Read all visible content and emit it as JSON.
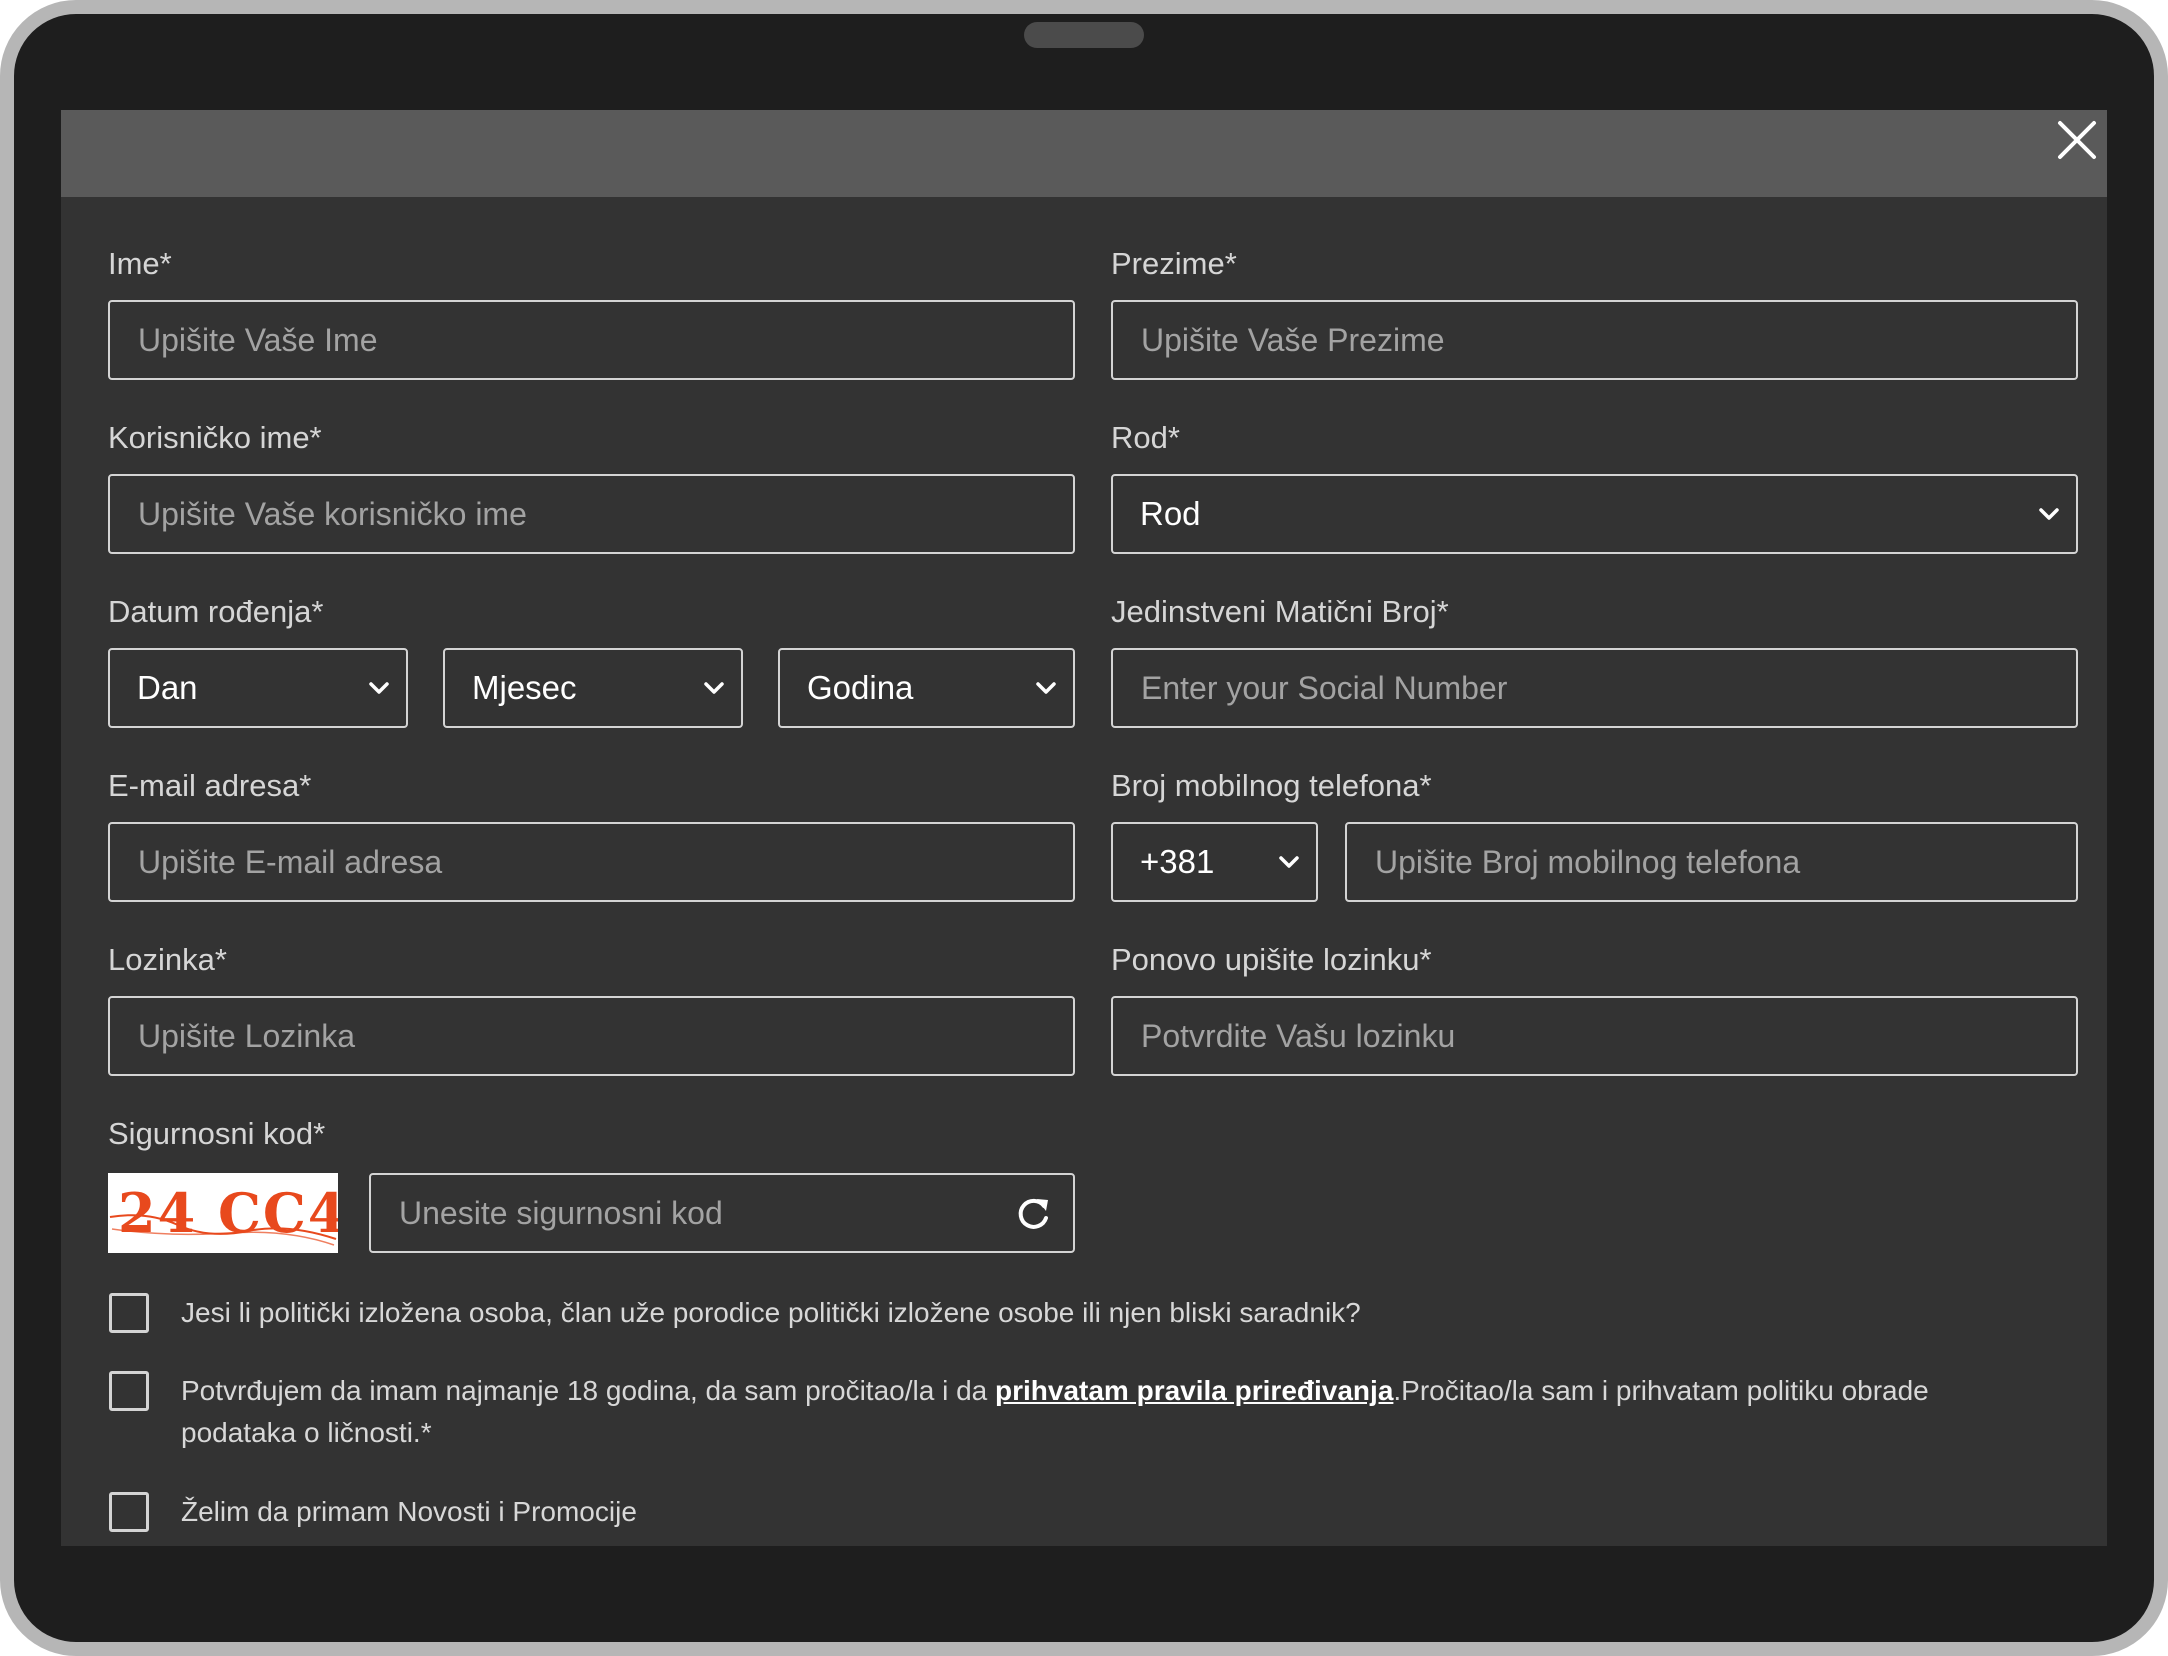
{
  "form": {
    "first_name": {
      "label": "Ime*",
      "placeholder": "Upišite Vaše Ime"
    },
    "last_name": {
      "label": "Prezime*",
      "placeholder": "Upišite Vaše Prezime"
    },
    "username": {
      "label": "Korisničko ime*",
      "placeholder": "Upišite Vaše korisničko ime"
    },
    "gender": {
      "label": "Rod*",
      "selected": "Rod"
    },
    "birth_date": {
      "label": "Datum rođenja*",
      "day": "Dan",
      "month": "Mjesec",
      "year": "Godina"
    },
    "jmbg": {
      "label": "Jedinstveni Matični Broj*",
      "placeholder": "Enter your Social Number"
    },
    "email": {
      "label": "E-mail adresa*",
      "placeholder": "Upišite E-mail adresa"
    },
    "phone": {
      "label": "Broj mobilnog telefona*",
      "country_code": "+381",
      "placeholder": "Upišite Broj mobilnog telefona"
    },
    "password": {
      "label": "Lozinka*",
      "placeholder": "Upišite Lozinka"
    },
    "password_confirm": {
      "label": "Ponovo upišite lozinku*",
      "placeholder": "Potvrdite Vašu lozinku"
    },
    "captcha": {
      "label": "Sigurnosni kod*",
      "code": "24 CC4",
      "placeholder": "Unesite sigurnosni kod"
    },
    "checkboxes": {
      "pep": "Jesi li politički izložena osoba, član uže porodice politički izložene osobe ili njen bliski saradnik?",
      "terms_before": "Potvrđujem da imam najmanje 18 godina, da sam pročitao/la i da ",
      "terms_link": "prihvatam pravila priređivanja",
      "terms_after": ".Pročitao/la sam i prihvatam politiku obrade podataka o ličnosti.*",
      "news": "Želim da primam Novosti i Promocije"
    }
  },
  "icons": {
    "close": "close-icon",
    "chevron": "chevron-down-icon",
    "refresh": "refresh-icon"
  },
  "colors": {
    "panel": "#333333",
    "header": "#5a5a5a",
    "captcha_text": "#e8491d"
  }
}
